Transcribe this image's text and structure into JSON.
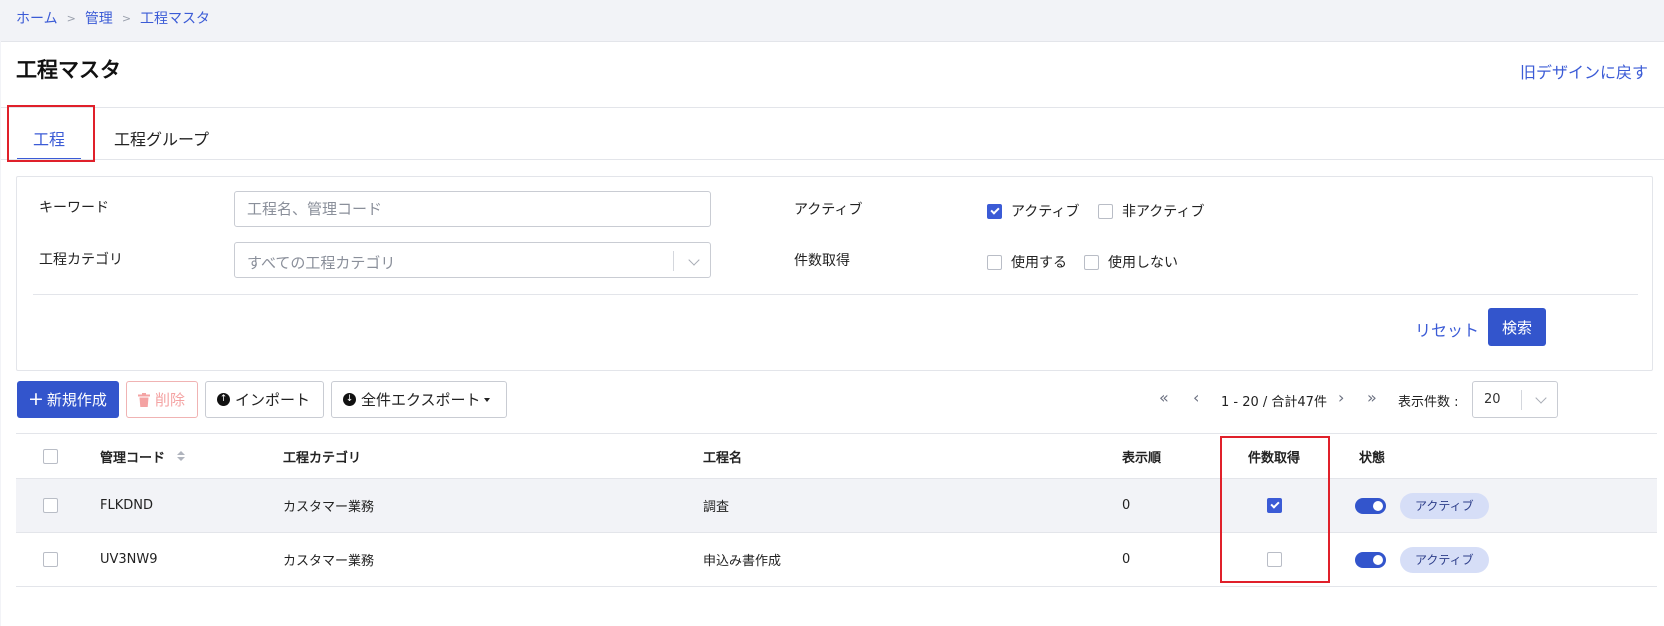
{
  "breadcrumb": [
    "ホーム",
    "管理",
    "工程マスタ"
  ],
  "breadcrumb_sep": ">",
  "page": {
    "title": "工程マスタ",
    "old_design_link": "旧デザインに戻す"
  },
  "tabs": [
    {
      "label": "工程",
      "active": true
    },
    {
      "label": "工程グループ",
      "active": false
    }
  ],
  "filters": {
    "keyword_label": "キーワード",
    "keyword_placeholder": "工程名、管理コード",
    "category_label": "工程カテゴリ",
    "category_placeholder": "すべての工程カテゴリ",
    "active_label": "アクティブ",
    "active_options": [
      {
        "label": "アクティブ",
        "checked": true
      },
      {
        "label": "非アクティブ",
        "checked": false
      }
    ],
    "count_label": "件数取得",
    "count_options": [
      {
        "label": "使用する",
        "checked": false
      },
      {
        "label": "使用しない",
        "checked": false
      }
    ],
    "reset_label": "リセット",
    "search_label": "検索"
  },
  "toolbar": {
    "new_label": "新規作成",
    "delete_label": "削除",
    "import_label": "インポート",
    "export_label": "全件エクスポート"
  },
  "pagination": {
    "range_text": "1 - 20 / 合計47件",
    "page_size_label": "表示件数 :",
    "page_size_value": "20"
  },
  "table": {
    "headers": {
      "code": "管理コード",
      "category": "工程カテゴリ",
      "name": "工程名",
      "order": "表示順",
      "count": "件数取得",
      "status": "状態"
    },
    "rows": [
      {
        "code": "FLKDND",
        "category": "カスタマー業務",
        "name": "調査",
        "order": "0",
        "count_checked": true,
        "status": "アクティブ",
        "enabled": true
      },
      {
        "code": "UV3NW9",
        "category": "カスタマー業務",
        "name": "申込み書作成",
        "order": "0",
        "count_checked": false,
        "status": "アクティブ",
        "enabled": true
      }
    ]
  },
  "colors": {
    "accent": "#3355cc",
    "link": "#3b5bd6",
    "highlight_box": "#e0202a",
    "badge_bg": "#d6def7"
  }
}
